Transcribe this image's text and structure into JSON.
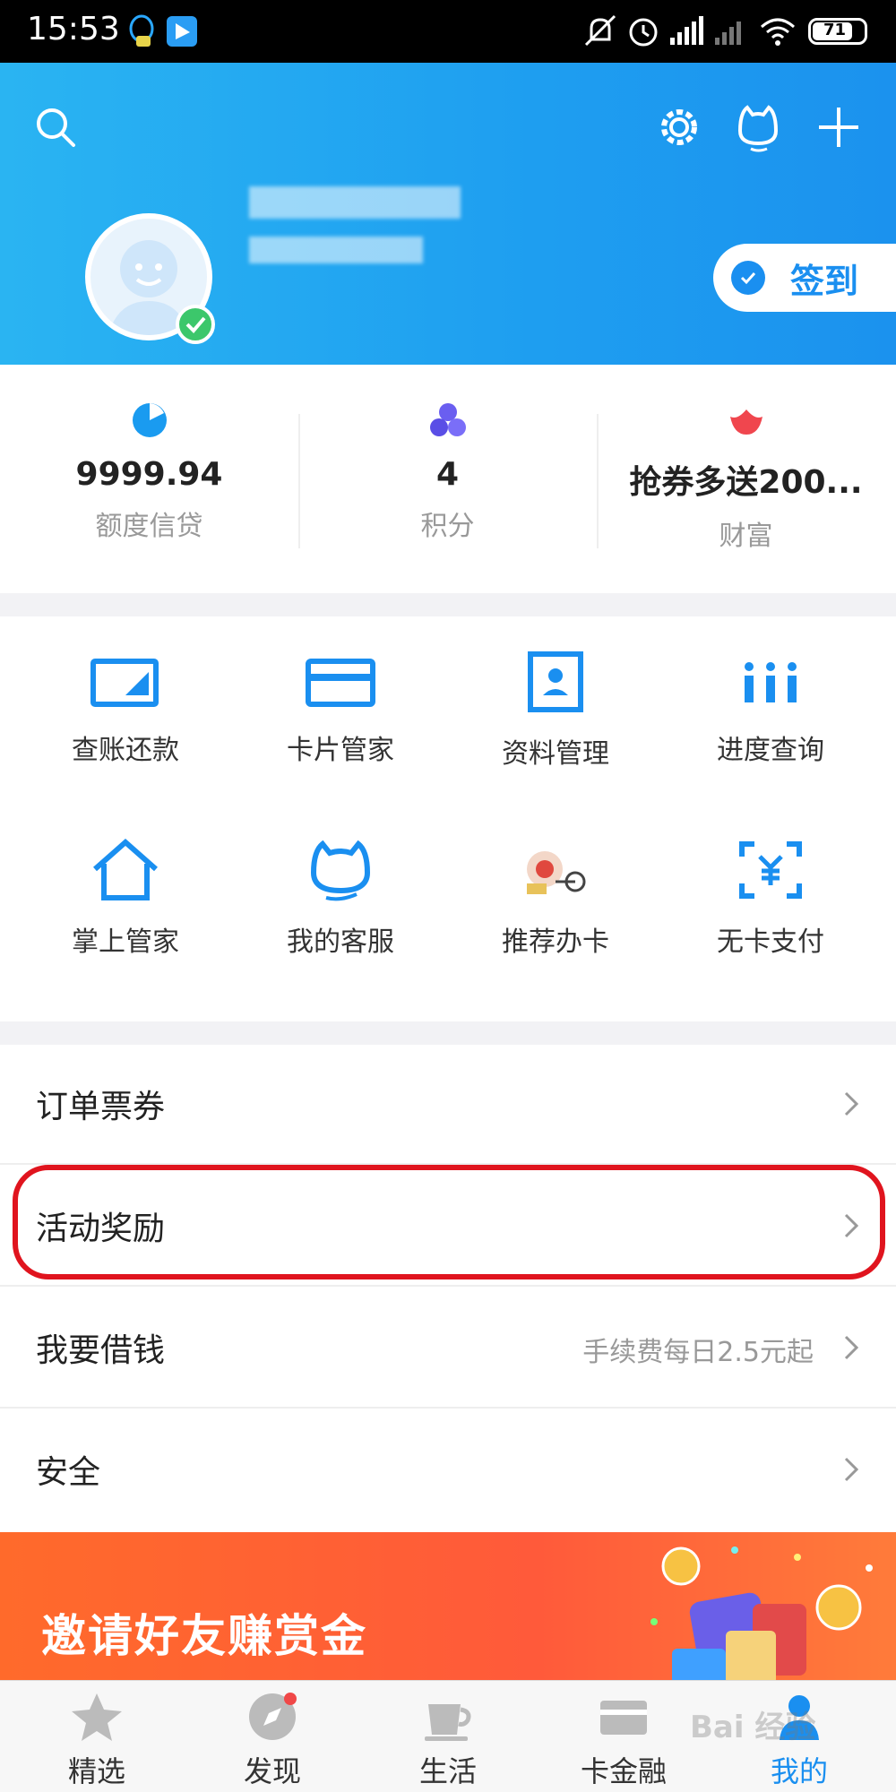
{
  "status_bar": {
    "time": "15:53",
    "battery": "71"
  },
  "header": {
    "signin_label": "签到"
  },
  "stats": [
    {
      "value": "9999.94",
      "label": "额度信贷"
    },
    {
      "value": "4",
      "label": "积分"
    },
    {
      "value": "抢券多送200...",
      "label": "财富"
    }
  ],
  "grid": [
    {
      "label": "查账还款",
      "icon": "bill-repay-icon"
    },
    {
      "label": "卡片管家",
      "icon": "card-icon"
    },
    {
      "label": "资料管理",
      "icon": "profile-icon"
    },
    {
      "label": "进度查询",
      "icon": "progress-icon"
    },
    {
      "label": "掌上管家",
      "icon": "home-icon"
    },
    {
      "label": "我的客服",
      "icon": "service-icon"
    },
    {
      "label": "推荐办卡",
      "icon": "recommend-card-icon"
    },
    {
      "label": "无卡支付",
      "icon": "cardless-pay-icon"
    }
  ],
  "list": [
    {
      "label": "订单票券",
      "sub": ""
    },
    {
      "label": "活动奖励",
      "sub": ""
    },
    {
      "label": "我要借钱",
      "sub": "手续费每日2.5元起"
    },
    {
      "label": "安全",
      "sub": ""
    }
  ],
  "banner": {
    "title": "邀请好友赚赏金"
  },
  "tabs": [
    {
      "label": "精选",
      "icon": "star-icon"
    },
    {
      "label": "发现",
      "icon": "compass-icon"
    },
    {
      "label": "生活",
      "icon": "cup-icon"
    },
    {
      "label": "卡金融",
      "icon": "card-finance-icon"
    },
    {
      "label": "我的",
      "icon": "person-icon"
    }
  ],
  "colors": {
    "primary": "#1a8ff0",
    "header": "#1e9ef0",
    "highlight": "#e0141e",
    "banner": "#ff5a3a"
  }
}
